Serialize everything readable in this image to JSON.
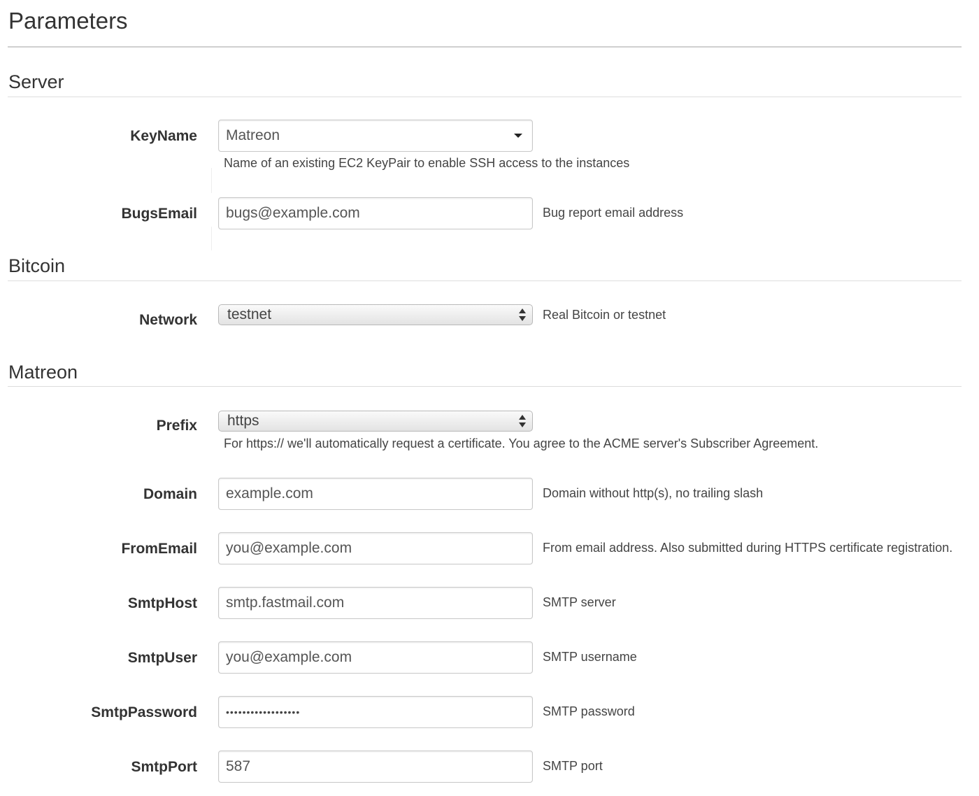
{
  "page": {
    "title": "Parameters"
  },
  "sections": {
    "server": {
      "title": "Server",
      "keyname": {
        "label": "KeyName",
        "value": "Matreon",
        "help": "Name of an existing EC2 KeyPair to enable SSH access to the instances"
      },
      "bugsemail": {
        "label": "BugsEmail",
        "value": "bugs@example.com",
        "help": "Bug report email address"
      }
    },
    "bitcoin": {
      "title": "Bitcoin",
      "network": {
        "label": "Network",
        "value": "testnet",
        "help": "Real Bitcoin or testnet"
      }
    },
    "matreon": {
      "title": "Matreon",
      "prefix": {
        "label": "Prefix",
        "value": "https",
        "help": "For https:// we'll automatically request a certificate. You agree to the ACME server's Subscriber Agreement."
      },
      "domain": {
        "label": "Domain",
        "value": "example.com",
        "help": "Domain without http(s), no trailing slash"
      },
      "fromemail": {
        "label": "FromEmail",
        "value": "you@example.com",
        "help": "From email address. Also submitted during HTTPS certificate registration."
      },
      "smtphost": {
        "label": "SmtpHost",
        "value": "smtp.fastmail.com",
        "help": "SMTP server"
      },
      "smtpuser": {
        "label": "SmtpUser",
        "value": "you@example.com",
        "help": "SMTP username"
      },
      "smtppassword": {
        "label": "SmtpPassword",
        "value": "••••••••••••••••••",
        "help": "SMTP password"
      },
      "smtpport": {
        "label": "SmtpPort",
        "value": "587",
        "help": "SMTP port"
      }
    }
  }
}
